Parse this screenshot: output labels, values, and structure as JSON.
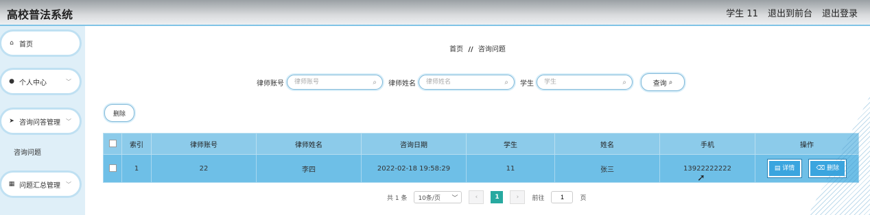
{
  "header": {
    "app_title": "高校普法系统",
    "user_label": "学生 11",
    "exit_front": "退出到前台",
    "logout": "退出登录"
  },
  "sidebar": {
    "items": [
      {
        "label": "首页",
        "icon": "home-icon"
      },
      {
        "label": "个人中心",
        "icon": "user-icon"
      },
      {
        "label": "咨询问答管理",
        "icon": "send-icon"
      },
      {
        "label": "问题汇总管理",
        "icon": "grid-icon"
      }
    ],
    "submenu_item": "咨询问题"
  },
  "breadcrumb": {
    "home": "首页",
    "separator": "//",
    "current": "咨询问题"
  },
  "search": {
    "lawyer_account_label": "律师账号",
    "lawyer_account_placeholder": "律师账号",
    "lawyer_name_label": "律师姓名",
    "lawyer_name_placeholder": "律师姓名",
    "student_label": "学生",
    "student_placeholder": "学生",
    "query_label": "查询"
  },
  "toolbar": {
    "delete_label": "删除"
  },
  "table": {
    "columns": [
      "索引",
      "律师账号",
      "律师姓名",
      "咨询日期",
      "学生",
      "姓名",
      "手机",
      "操作"
    ],
    "rows": [
      {
        "index": "1",
        "lawyer_account": "22",
        "lawyer_name": "李四",
        "date": "2022-02-18 19:58:29",
        "student": "11",
        "name": "张三",
        "phone": "13922222222"
      }
    ],
    "detail_label": "详情",
    "delete_label": "删除"
  },
  "pager": {
    "total": "共 1 条",
    "page_size": "10条/页",
    "current_page": "1",
    "goto_prefix": "前往",
    "goto_value": "1",
    "goto_suffix": "页"
  },
  "colors": {
    "header_row": "#8ccbea",
    "body_row": "#6ebfe7",
    "accent": "#3aa5df",
    "pager_active": "#27a9a0"
  }
}
